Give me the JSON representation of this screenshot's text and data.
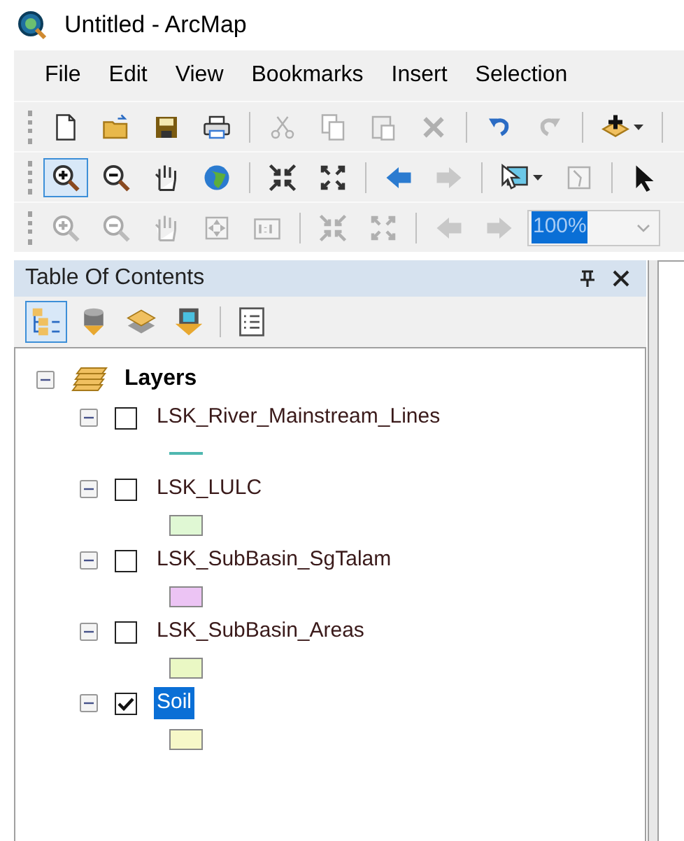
{
  "window": {
    "title": "Untitled - ArcMap"
  },
  "menu": [
    "File",
    "Edit",
    "View",
    "Bookmarks",
    "Insert",
    "Selection"
  ],
  "toolbars": [
    {
      "buttons": [
        {
          "kind": "new",
          "disabled": false
        },
        {
          "kind": "open",
          "disabled": false
        },
        {
          "kind": "save",
          "disabled": false
        },
        {
          "kind": "print",
          "disabled": false
        },
        {
          "kind": "sep"
        },
        {
          "kind": "cut",
          "disabled": true
        },
        {
          "kind": "copy",
          "disabled": true
        },
        {
          "kind": "paste",
          "disabled": true
        },
        {
          "kind": "delete",
          "disabled": true
        },
        {
          "kind": "sep"
        },
        {
          "kind": "undo",
          "disabled": false
        },
        {
          "kind": "redo",
          "disabled": true
        },
        {
          "kind": "sep"
        },
        {
          "kind": "adddata",
          "disabled": false,
          "dropdown": true
        },
        {
          "kind": "sep"
        }
      ]
    },
    {
      "buttons": [
        {
          "kind": "zoomin",
          "disabled": false,
          "selected": true
        },
        {
          "kind": "zoomout",
          "disabled": false,
          "selected": false
        },
        {
          "kind": "pan",
          "disabled": false,
          "selected": false
        },
        {
          "kind": "globe",
          "disabled": false,
          "selected": false
        },
        {
          "kind": "sep"
        },
        {
          "kind": "fixedin",
          "disabled": false
        },
        {
          "kind": "fixedout",
          "disabled": false
        },
        {
          "kind": "sep"
        },
        {
          "kind": "back",
          "disabled": false
        },
        {
          "kind": "forward",
          "disabled": true
        },
        {
          "kind": "sep"
        },
        {
          "kind": "selectfeatures",
          "disabled": false,
          "dropdown": true
        },
        {
          "kind": "clearselection",
          "disabled": true
        },
        {
          "kind": "sep"
        },
        {
          "kind": "pointer",
          "disabled": false,
          "selected": false
        }
      ]
    },
    {
      "buttons": [
        {
          "kind": "zoomin",
          "disabled": true
        },
        {
          "kind": "zoomout",
          "disabled": true
        },
        {
          "kind": "pan",
          "disabled": true
        },
        {
          "kind": "fullpage",
          "disabled": true
        },
        {
          "kind": "oneone",
          "disabled": true
        },
        {
          "kind": "sep"
        },
        {
          "kind": "fixedin",
          "disabled": true
        },
        {
          "kind": "fixedout",
          "disabled": true
        },
        {
          "kind": "sep"
        },
        {
          "kind": "back",
          "disabled": true
        },
        {
          "kind": "forward",
          "disabled": true
        },
        {
          "kind": "scale",
          "value": "100%",
          "disabled": true
        }
      ]
    }
  ],
  "toc": {
    "title": "Table Of Contents",
    "tools": [
      {
        "kind": "drawingorder",
        "selected": true
      },
      {
        "kind": "source",
        "selected": false
      },
      {
        "kind": "visibility",
        "selected": false
      },
      {
        "kind": "selection",
        "selected": false
      },
      {
        "kind": "sep"
      },
      {
        "kind": "options",
        "selected": false
      }
    ],
    "frame": {
      "label": "Layers",
      "expanded": true,
      "children": [
        {
          "label": "LSK_River_Mainstream_Lines",
          "expanded": true,
          "checked": false,
          "selected": false,
          "symbol": {
            "kind": "line",
            "color": "#4fb8b0"
          }
        },
        {
          "label": "LSK_LULC",
          "expanded": true,
          "checked": false,
          "selected": false,
          "symbol": {
            "kind": "fill",
            "color": "#e0f8d4"
          }
        },
        {
          "label": "LSK_SubBasin_SgTalam",
          "expanded": true,
          "checked": false,
          "selected": false,
          "symbol": {
            "kind": "fill",
            "color": "#ecc4f4"
          }
        },
        {
          "label": "LSK_SubBasin_Areas",
          "expanded": true,
          "checked": false,
          "selected": false,
          "symbol": {
            "kind": "fill",
            "color": "#eaf8c4"
          }
        },
        {
          "label": "Soil",
          "expanded": true,
          "checked": true,
          "selected": true,
          "symbol": {
            "kind": "fill",
            "color": "#f6f8c8"
          }
        }
      ]
    }
  }
}
